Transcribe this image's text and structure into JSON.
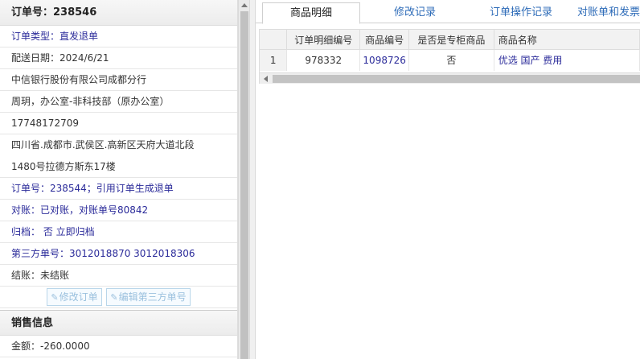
{
  "order": {
    "header": "订单号：238546",
    "type": "订单类型：直发退单",
    "delivery_date": "配送日期：2024/6/21",
    "company": "中信银行股份有限公司成都分行",
    "contact": "周玥，办公室-非科技部（原办公室）",
    "phone": "17748172709",
    "address_line1": "四川省.成都市.武侯区.高新区天府大道北段",
    "address_line2": "1480号拉德方斯东17楼",
    "ref_order": "订单号：238544；引用订单生成退单",
    "reconcile": "对账：已对账，对账单号80842",
    "archive": "归档： 否 立即归档",
    "third_party": "第三方单号：3012018870 3012018306",
    "settle": "结账：未结账"
  },
  "buttons": {
    "edit_order": "修改订单",
    "edit_third_party": "编辑第三方单号"
  },
  "sales": {
    "header": "销售信息",
    "amount": "金额：-260.0000"
  },
  "tabs": [
    {
      "label": "商品明细"
    },
    {
      "label": "修改记录"
    },
    {
      "label": "订单操作记录"
    },
    {
      "label": "对账单和发票"
    }
  ],
  "table": {
    "columns": [
      "订单明细编号",
      "商品编号",
      "是否是专柜商品",
      "商品名称"
    ],
    "rows": [
      {
        "row_num": "1",
        "detail_id": "978332",
        "product_id": "1098726",
        "is_counter": "否",
        "name": "优选 国产 费用"
      }
    ]
  }
}
